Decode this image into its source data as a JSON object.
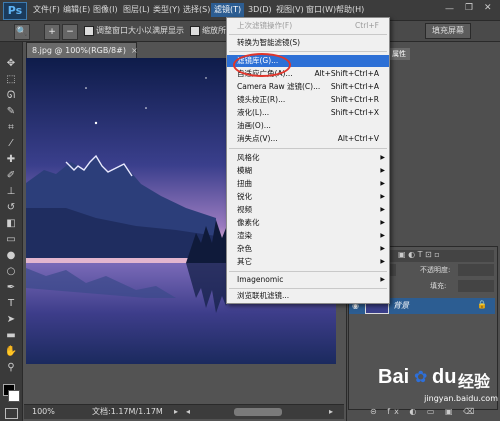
{
  "menubar": {
    "logo": "Ps",
    "items": [
      "文件(F)",
      "编辑(E)",
      "图像(I)",
      "图层(L)",
      "类型(Y)",
      "选择(S)",
      "滤镜(T)",
      "3D(D)",
      "视图(V)",
      "窗口(W)",
      "帮助(H)"
    ]
  },
  "options": {
    "checkbox1_label": "调整窗口大小以满屏显示",
    "checkbox2_label": "缩放所有",
    "fill_screen": "填充屏幕"
  },
  "document": {
    "tab_title": "8.jpg @ 100%(RGB/8#)",
    "close_glyph": "×",
    "zoom": "100%",
    "file_info": "文档:1.17M/1.17M"
  },
  "right_panel": {
    "tabs": [
      "颜色",
      "属性"
    ],
    "opacity_label": "不透明度:",
    "fill_label": "填充:",
    "layer_name": "背景"
  },
  "filter_menu": {
    "items": [
      {
        "label": "上次滤镜操作(F)",
        "shortcut": "Ctrl+F",
        "disabled": true
      },
      {
        "label": "转换为智能滤镜(S)",
        "shortcut": ""
      },
      {
        "label": "滤镜库(G)...",
        "shortcut": "",
        "highlight": true
      },
      {
        "label": "自适应广角(A)...",
        "shortcut": "Alt+Shift+Ctrl+A"
      },
      {
        "label": "Camera Raw 滤镜(C)...",
        "shortcut": "Shift+Ctrl+A"
      },
      {
        "label": "镜头校正(R)...",
        "shortcut": "Shift+Ctrl+R"
      },
      {
        "label": "液化(L)...",
        "shortcut": "Shift+Ctrl+X"
      },
      {
        "label": "油画(O)...",
        "shortcut": ""
      },
      {
        "label": "消失点(V)...",
        "shortcut": "Alt+Ctrl+V"
      },
      {
        "label": "风格化",
        "submenu": true
      },
      {
        "label": "模糊",
        "submenu": true
      },
      {
        "label": "扭曲",
        "submenu": true
      },
      {
        "label": "锐化",
        "submenu": true
      },
      {
        "label": "视频",
        "submenu": true
      },
      {
        "label": "像素化",
        "submenu": true
      },
      {
        "label": "渲染",
        "submenu": true
      },
      {
        "label": "杂色",
        "submenu": true
      },
      {
        "label": "其它",
        "submenu": true
      },
      {
        "label": "Imagenomic",
        "submenu": true
      },
      {
        "label": "浏览联机滤镜...",
        "shortcut": ""
      }
    ]
  },
  "watermark": {
    "brand_latin": "Bai",
    "brand_mid": "du",
    "brand_cn": "经验",
    "url": "jingyan.baidu.com"
  },
  "colors": {
    "highlight": "#2d70d6",
    "annotation": "#e0352b"
  }
}
